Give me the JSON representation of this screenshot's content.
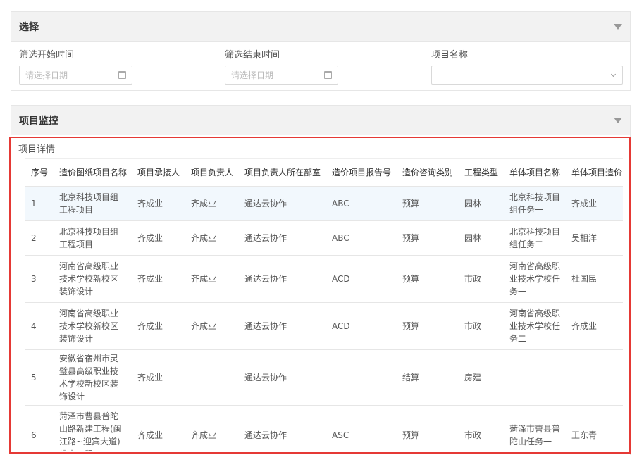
{
  "filter_panel": {
    "title": "选择",
    "start_label": "筛选开始时间",
    "start_placeholder": "请选择日期",
    "end_label": "筛选结束时间",
    "end_placeholder": "请选择日期",
    "project_label": "项目名称",
    "project_value": ""
  },
  "monitor_panel": {
    "title": "项目监控",
    "detail_label": "项目详情"
  },
  "table": {
    "headers": [
      "序号",
      "造价图纸项目名称",
      "项目承接人",
      "项目负责人",
      "项目负责人所在部室",
      "造价项目报告号",
      "造价咨询类别",
      "工程类型",
      "单体项目名称",
      "单体项目造价"
    ],
    "rows": [
      [
        "1",
        "北京科技项目组工程项目",
        "齐成业",
        "齐成业",
        "通达云协作",
        "ABC",
        "预算",
        "园林",
        "北京科技项目组任务一",
        "齐成业"
      ],
      [
        "2",
        "北京科技项目组工程项目",
        "齐成业",
        "齐成业",
        "通达云协作",
        "ABC",
        "预算",
        "园林",
        "北京科技项目组任务二",
        "吴相洋"
      ],
      [
        "3",
        "河南省高级职业技术学校新校区装饰设计",
        "齐成业",
        "齐成业",
        "通达云协作",
        "ACD",
        "预算",
        "市政",
        "河南省高级职业技术学校任务一",
        "杜国民"
      ],
      [
        "4",
        "河南省高级职业技术学校新校区装饰设计",
        "齐成业",
        "齐成业",
        "通达云协作",
        "ACD",
        "预算",
        "市政",
        "河南省高级职业技术学校任务二",
        "齐成业"
      ],
      [
        "5",
        "安徽省宿州市灵璧县高级职业技术学校新校区装饰设计",
        "齐成业",
        "",
        "通达云协作",
        "",
        "结算",
        "房建",
        "",
        ""
      ],
      [
        "6",
        "菏泽市曹县普陀山路新建工程(闽江路~迎宾大道)排水工程",
        "齐成业",
        "齐成业",
        "通达云协作",
        "ASC",
        "预算",
        "市政",
        "菏泽市曹县普陀山任务一",
        "王东青"
      ]
    ]
  }
}
